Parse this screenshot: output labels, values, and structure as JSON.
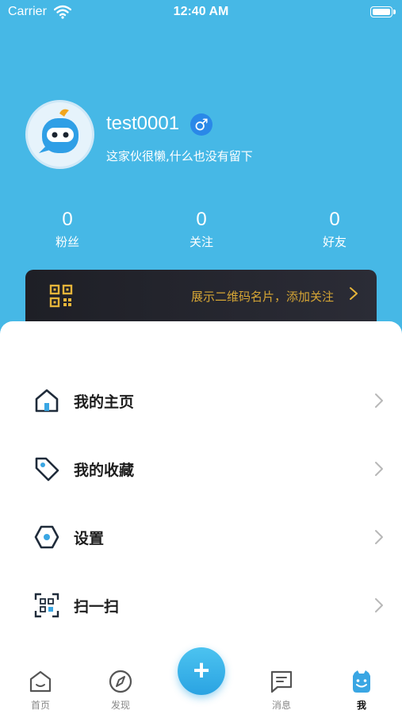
{
  "status_bar": {
    "carrier": "Carrier",
    "time": "12:40 AM"
  },
  "profile": {
    "username": "test0001",
    "gender_symbol": "♂",
    "bio": "这家伙很懒,什么也没有留下"
  },
  "stats": [
    {
      "value": "0",
      "label": "粉丝"
    },
    {
      "value": "0",
      "label": "关注"
    },
    {
      "value": "0",
      "label": "好友"
    }
  ],
  "qr_banner": {
    "text": "展示二维码名片，添加关注"
  },
  "menu": [
    {
      "label": "我的主页",
      "icon": "home-icon"
    },
    {
      "label": "我的收藏",
      "icon": "tag-icon"
    },
    {
      "label": "设置",
      "icon": "settings-hexagon-icon"
    },
    {
      "label": "扫一扫",
      "icon": "scan-icon"
    }
  ],
  "tabbar": {
    "items": [
      {
        "label": "首页",
        "icon": "home-tab-icon"
      },
      {
        "label": "发现",
        "icon": "compass-icon"
      },
      {
        "label": "消息",
        "icon": "message-icon"
      },
      {
        "label": "我",
        "icon": "smiley-icon"
      }
    ],
    "fab_label": "+"
  },
  "colors": {
    "header_bg": "#46b8e6",
    "accent": "#2aa3e2",
    "banner_text": "#d5a535"
  }
}
